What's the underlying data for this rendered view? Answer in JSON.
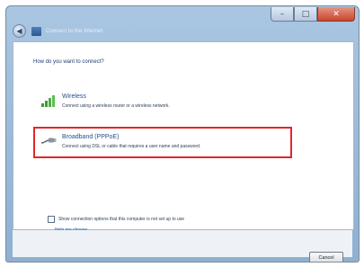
{
  "window": {
    "title": "Connect to the Internet",
    "controls": {
      "minimize": "–",
      "maximize": "□",
      "close": "✕"
    }
  },
  "wizard": {
    "question": "How do you want to connect?",
    "options": [
      {
        "title": "Wireless",
        "description": "Connect using a wireless router or a wireless network.",
        "icon": "wireless-signal-icon"
      },
      {
        "title": "Broadband (PPPoE)",
        "description": "Connect using DSL or cable that requires a user name and password.",
        "icon": "broadband-cable-icon"
      }
    ],
    "checkbox_label": "Show connection options that this computer is not set up to use",
    "help_link": "Help me choose",
    "cancel_label": "Cancel"
  },
  "colors": {
    "highlight": "#e2262a",
    "title_text": "#1f4f8c",
    "link": "#1f5ca8"
  }
}
